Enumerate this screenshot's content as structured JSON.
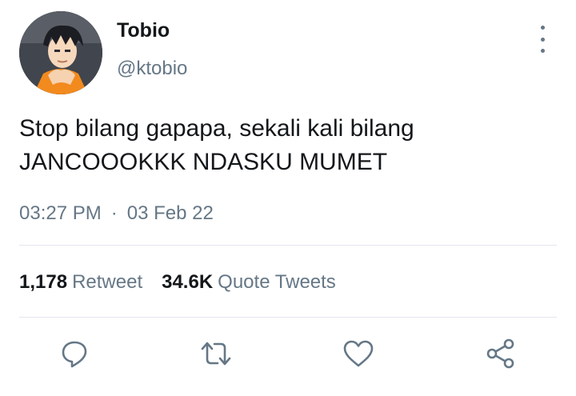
{
  "user": {
    "display_name": "Tobio",
    "handle": "@ktobio"
  },
  "tweet": {
    "lines": [
      "Stop bilang gapapa, sekali kali bilang",
      "JANCOOOKKK NDASKU MUMET"
    ],
    "time": "03:27 PM",
    "separator": "·",
    "date": "03 Feb 22"
  },
  "stats": {
    "retweets_count": "1,178",
    "retweets_label": "Retweet",
    "quotes_count": "34.6K",
    "quotes_label": "Quote Tweets"
  },
  "actions": {
    "reply_icon": "reply-icon",
    "retweet_icon": "retweet-icon",
    "like_icon": "heart-icon",
    "share_icon": "share-icon"
  },
  "colors": {
    "text": "#14171a",
    "secondary": "#657786",
    "divider": "#e1e8ed",
    "icon": "#657786"
  }
}
